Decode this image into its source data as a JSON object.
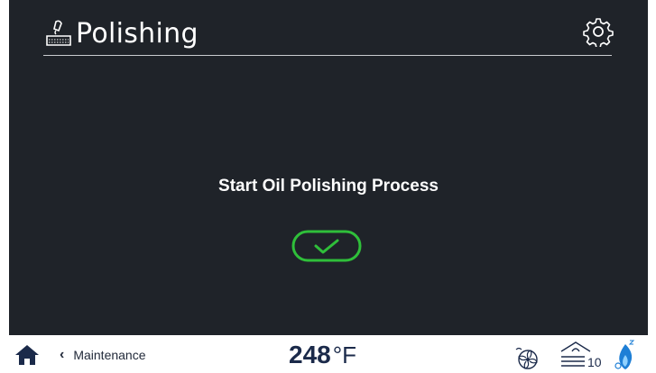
{
  "header": {
    "title": "Polishing"
  },
  "main": {
    "prompt": "Start Oil Polishing Process"
  },
  "statusbar": {
    "back_label": "Maintenance",
    "temperature_value": "248",
    "temperature_unit": "°F",
    "oil_level": "10"
  },
  "colors": {
    "screen_bg": "#1f2329",
    "confirm_green": "#2fbf3a",
    "navy": "#1b2a4a"
  },
  "icons": {
    "title": "fryer-polish-icon",
    "settings": "gear-icon",
    "confirm": "checkmark-icon",
    "home": "home-icon",
    "back": "chevron-left-icon",
    "fan": "fan-icon",
    "oil": "oil-level-icon",
    "flame": "flame-icon"
  }
}
